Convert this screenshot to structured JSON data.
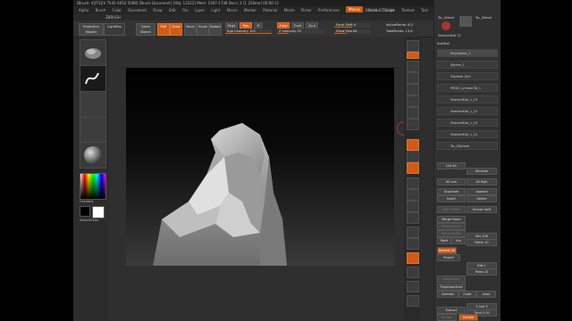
{
  "titlebar": {
    "title": "[Brush: 4][TS][V 7542-4052-5088]   [Brush Document]   [Obj: 13312] Mem: 1567-1738 Docs: 2 [1 256mo] 00:00:11"
  },
  "menubar": {
    "items": [
      "Alpha",
      "Brush",
      "Color",
      "Document",
      "Draw",
      "Edit",
      "File",
      "Layer",
      "Light",
      "Macro",
      "Marker",
      "Material",
      "Movie",
      "Picker",
      "Preferences",
      "Render",
      "Stencil",
      "Stroke",
      "Texture",
      "Tool",
      "Transform",
      "Zplugin",
      "Zscript"
    ],
    "highlight_label": "Menus",
    "script_label": "DefaultZScript"
  },
  "subbar": {
    "label": "ZBRUSH"
  },
  "toolbar": {
    "projection_master": "Projection Master",
    "lightbox": "LightBox",
    "quick_sketch": "Quick Sketch",
    "edit": "Edit",
    "draw": "Draw",
    "move": "Move",
    "scale": "Scale",
    "rotate": "Rotate",
    "mrgb": "Mrgb",
    "rgb": "Rgb",
    "m": "M",
    "rgb_intensity": "Rgb Intensity 100",
    "zadd": "Zadd",
    "zsub": "Zsub",
    "zcut": "Zcut",
    "z_intensity": "Z Intensity 25",
    "focal_shift": "Focal Shift 0",
    "draw_size": "Draw Size 64",
    "active_points": "ActivePoints: 6,2",
    "total_points": "TotalPoints: 13,6"
  },
  "left_shelf": {
    "gradient_label": "Gradient",
    "switch_color_label": "SwitchColor",
    "accent_color": "#d05a16"
  },
  "right_panel": {
    "subtool_header": "SubTool",
    "top_labels": [
      "Tsc_Shbvel",
      "Tsc_Shbvel",
      "ShabvelKlot 23"
    ],
    "subtools": [
      "Polysphere_1",
      "Sphere_1",
      "ZSphere_Str1",
      "PM3D_Cylinder3D_1",
      "ShabvelKlot_1_10",
      "ShabvelKlot_1_10",
      "ShabvelKlot_1_10",
      "ShabvelKlot_1_10",
      "Tsc_ZSphere"
    ],
    "list_all": "List  All",
    "rename": "Rename",
    "all_low": "All Low",
    "all_high": "All High",
    "duplicate": "Duplicate",
    "append": "Append",
    "insert": "Insert",
    "delete": "Delete",
    "split_hidden": "Split Hidden",
    "groups_split": "Groups Split",
    "merge_down": "Merge Down",
    "merge_similar": "MergeSimilar",
    "merge_visible": "MergeVisible",
    "weld": "Weld",
    "uvs": "Uvs",
    "res": "Res 128",
    "polish": "Polish 10",
    "remesh_all": "Remesh All",
    "project": "Project",
    "dist": "Dist 1",
    "mean": "Mean 25",
    "shadowbox": "Shadowbox",
    "projection_shell": "ProjectionShell",
    "farthest": "Farthest",
    "outer": "Outer",
    "inner": "Inner",
    "extract": "Extract",
    "s_smt": "S Smt 5",
    "thick": "Thick 0.02",
    "accept": "Accept",
    "double": "Double"
  },
  "icons": [
    "brush-icon",
    "stroke-icon",
    "alpha-icon",
    "texture-icon",
    "material-icon",
    "color-picker-icon",
    "bpr-icon",
    "scroll-icon",
    "zoom-icon",
    "actual-icon",
    "aahalf-icon",
    "persp-icon",
    "floor-icon",
    "local-icon",
    "lsym-icon",
    "xyz-icon",
    "frame-icon",
    "move-icon",
    "scale-icon",
    "rotate-icon",
    "polyf-icon",
    "transp-icon",
    "ghost-icon",
    "solo-icon",
    "xpose-icon"
  ]
}
